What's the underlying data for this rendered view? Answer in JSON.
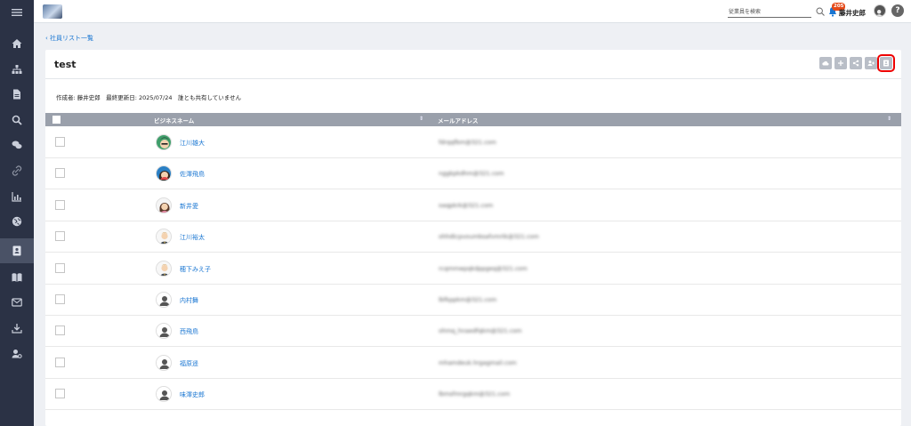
{
  "topbar": {
    "search_placeholder": "従業員を検索",
    "notification_count": "205",
    "user_name": "藤井史郎",
    "help": "?"
  },
  "breadcrumb": {
    "back_label": "社員リスト一覧"
  },
  "card": {
    "title": "test",
    "meta": "作成者: 藤井史郎　最終更新日: 2025/07/24　誰とも共有していません"
  },
  "table": {
    "columns": [
      "ビジネスネーム",
      "メールアドレス"
    ],
    "rows": [
      {
        "name": "江川雄大",
        "email": "fdrqqfbm@321.com",
        "avatar": "boy-green"
      },
      {
        "name": "佐澤飛鳥",
        "email": "nggkpkdhm@321.com",
        "avatar": "girl-blue"
      },
      {
        "name": "新井愛",
        "email": "oaqpkrk@321.com",
        "avatar": "girl-pink"
      },
      {
        "name": "江川裕太",
        "email": "ohhdtcpvoumbsafvmrtk@321.com",
        "avatar": "man-suit"
      },
      {
        "name": "穂下みえ子",
        "email": "rcqmmwpqkdppgeq@321.com",
        "avatar": "man-suit"
      },
      {
        "name": "内村舞",
        "email": "lbfkppkm@321.com",
        "avatar": "generic"
      },
      {
        "name": "西飛鳥",
        "email": "ohmq_hnaedfqkm@321.com",
        "avatar": "generic"
      },
      {
        "name": "福原遥",
        "email": "mhamdeuk.hrgagmail.com",
        "avatar": "generic"
      },
      {
        "name": "味澤史郎",
        "email": "lbmsfmrgqkm@321.com",
        "avatar": "generic"
      }
    ]
  },
  "sidebar_icons": [
    "menu-icon",
    "home-icon",
    "org-chart-icon",
    "document-icon",
    "search-icon",
    "chat-icon",
    "link-icon",
    "chart-icon",
    "globe-icon",
    "employee-list-icon",
    "book-icon",
    "mail-icon",
    "download-icon",
    "user-settings-icon"
  ],
  "colors": {
    "sidebar": "#2b3245",
    "accent": "#1976d2",
    "header": "#9aa0ab",
    "highlight": "#e00000",
    "badge": "#e64a19"
  }
}
